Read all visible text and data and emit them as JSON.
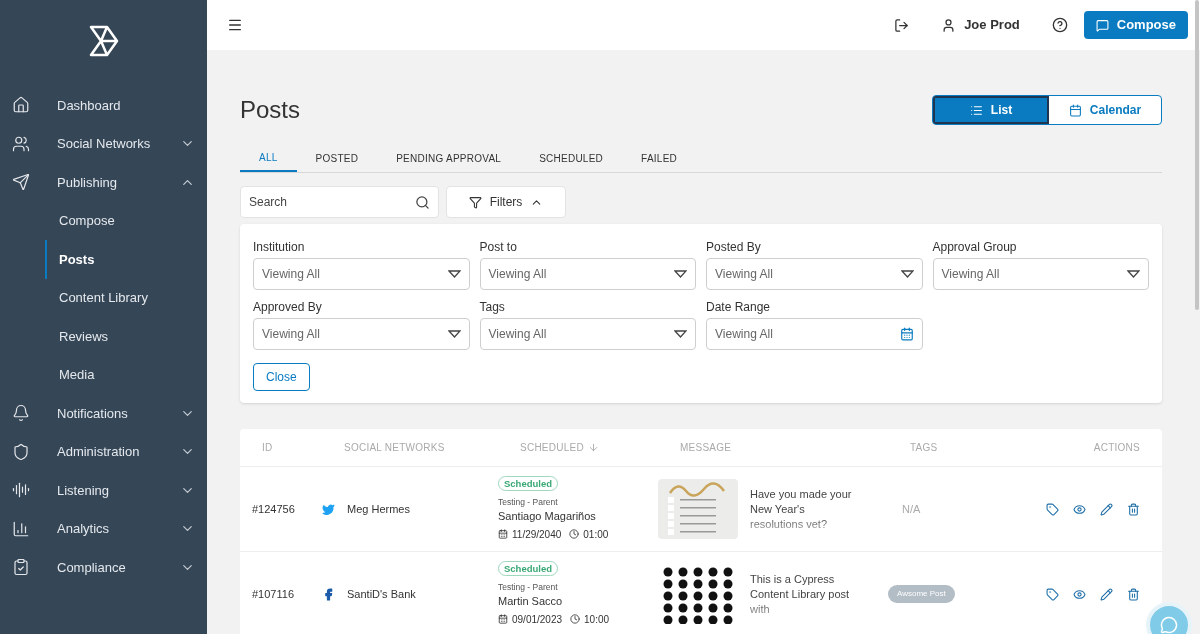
{
  "sidebar": {
    "items": [
      {
        "label": "Dashboard",
        "selected": false
      },
      {
        "label": "Social Networks",
        "selected": false,
        "expanded": false
      },
      {
        "label": "Publishing",
        "selected": false,
        "expanded": true,
        "children": [
          {
            "label": "Compose",
            "selected": false
          },
          {
            "label": "Posts",
            "selected": true
          },
          {
            "label": "Content Library",
            "selected": false
          },
          {
            "label": "Reviews",
            "selected": false
          },
          {
            "label": "Media",
            "selected": false
          }
        ]
      },
      {
        "label": "Notifications",
        "selected": false,
        "expanded": false
      },
      {
        "label": "Administration",
        "selected": false,
        "expanded": false
      },
      {
        "label": "Listening",
        "selected": false,
        "expanded": false
      },
      {
        "label": "Analytics",
        "selected": false,
        "expanded": false
      },
      {
        "label": "Compliance",
        "selected": false,
        "expanded": false
      }
    ]
  },
  "topbar": {
    "user": "Joe Prod",
    "compose": "Compose"
  },
  "page": {
    "title": "Posts",
    "views": [
      {
        "label": "List",
        "selected": true
      },
      {
        "label": "Calendar",
        "selected": false
      }
    ]
  },
  "tabs": [
    {
      "label": "ALL",
      "selected": true
    },
    {
      "label": "POSTED",
      "selected": false
    },
    {
      "label": "PENDING APPROVAL",
      "selected": false
    },
    {
      "label": "SCHEDULED",
      "selected": false
    },
    {
      "label": "FAILED",
      "selected": false
    }
  ],
  "search": {
    "placeholder": "Search"
  },
  "filters_button": {
    "label": "Filters",
    "expanded": true
  },
  "filters": [
    {
      "label": "Institution",
      "value": "Viewing All",
      "kind": "select"
    },
    {
      "label": "Post to",
      "value": "Viewing All",
      "kind": "select"
    },
    {
      "label": "Posted By",
      "value": "Viewing All",
      "kind": "select"
    },
    {
      "label": "Approval Group",
      "value": "Viewing All",
      "kind": "select"
    },
    {
      "label": "Approved By",
      "value": "Viewing All",
      "kind": "select"
    },
    {
      "label": "Tags",
      "value": "Viewing All",
      "kind": "select"
    },
    {
      "label": "Date Range",
      "value": "Viewing All",
      "kind": "date"
    }
  ],
  "close_button": "Close",
  "table": {
    "columns": [
      "ID",
      "SOCIAL NETWORKS",
      "SCHEDULED",
      "MESSAGE",
      "TAGS",
      "ACTIONS"
    ],
    "rows": [
      {
        "id": "#124756",
        "account": "Meg Hermes",
        "status": "Scheduled",
        "group": "Testing - Parent",
        "author": "Santiago Magariños",
        "date": "11/29/2040",
        "time": "01:00",
        "message": "Have you made your New Year's resolutions vet?",
        "tags": [],
        "no_tags": "N/A"
      },
      {
        "id": "#107116",
        "account": "SantiD's Bank",
        "status": "Scheduled",
        "group": "Testing - Parent",
        "author": "Martin Sacco",
        "date": "09/01/2023",
        "time": "10:00",
        "message": "This is a Cypress Content Library post with",
        "tags": [
          "Awsome Post"
        ]
      }
    ]
  }
}
